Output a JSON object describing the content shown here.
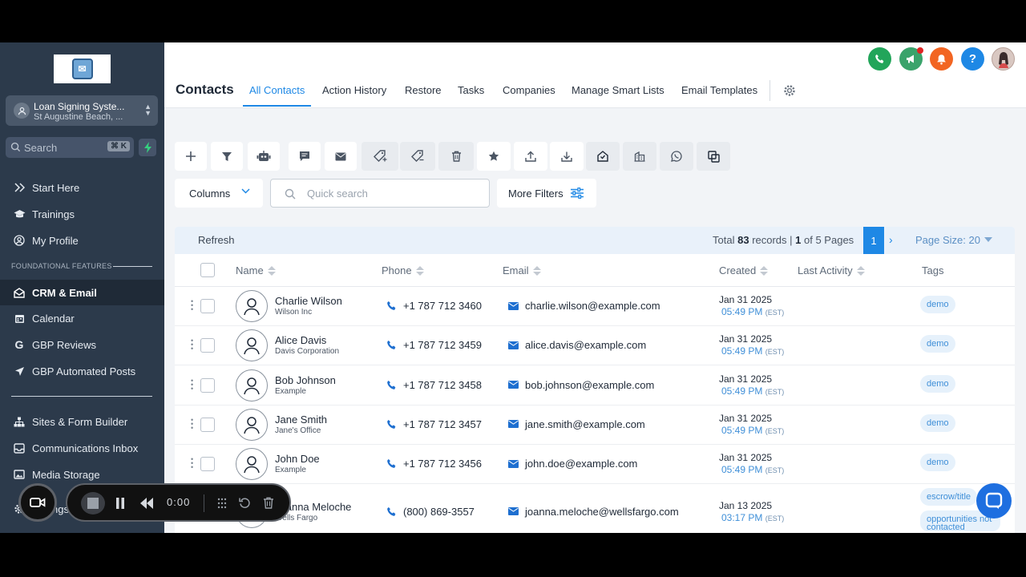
{
  "sidebar": {
    "location_name": "Loan Signing Syste...",
    "location_sub": "St Augustine Beach, ...",
    "search_placeholder": "Search",
    "search_shortcut": "⌘ K",
    "items": [
      {
        "label": "Start Here",
        "icon": "chevrons-right-icon"
      },
      {
        "label": "Trainings",
        "icon": "graduation-cap-icon"
      },
      {
        "label": "My Profile",
        "icon": "user-circle-icon"
      }
    ],
    "section_label": "FOUNDATIONAL FEATURES",
    "features": [
      {
        "label": "CRM & Email",
        "icon": "mail-open-icon",
        "active": true
      },
      {
        "label": "Calendar",
        "icon": "calendar-icon"
      },
      {
        "label": "GBP Reviews",
        "icon": "google-icon"
      },
      {
        "label": "GBP Automated Posts",
        "icon": "send-icon"
      }
    ],
    "more": [
      {
        "label": "Sites & Form Builder",
        "icon": "sitemap-icon"
      },
      {
        "label": "Communications Inbox",
        "icon": "inbox-icon"
      },
      {
        "label": "Media Storage",
        "icon": "image-icon"
      },
      {
        "label": "ngs",
        "icon": "settings-icon"
      }
    ]
  },
  "header": {
    "title": "Contacts",
    "tabs": [
      "All Contacts",
      "Action History",
      "Restore",
      "Tasks",
      "Companies",
      "Manage Smart Lists",
      "Email Templates"
    ],
    "active_tab": "All Contacts",
    "top_icons": [
      {
        "name": "phone-icon",
        "color": "#22a55a"
      },
      {
        "name": "megaphone-icon",
        "color": "#3aa36b"
      },
      {
        "name": "bell-icon",
        "color": "#f26522"
      },
      {
        "name": "help-icon",
        "color": "#1e88e5"
      }
    ]
  },
  "filters": {
    "columns_label": "Columns",
    "quick_search_placeholder": "Quick search",
    "more_filters_label": "More Filters"
  },
  "table": {
    "refresh_label": "Refresh",
    "total_prefix": "Total",
    "total_records": "83",
    "records_word": "records |",
    "page_current": "1",
    "of_pages": "of 5 Pages",
    "page_size_label": "Page Size: 20",
    "columns": [
      "Name",
      "Phone",
      "Email",
      "Created",
      "Last Activity",
      "Tags"
    ],
    "rows": [
      {
        "name": "Charlie Wilson",
        "company": "Wilson Inc",
        "phone": "+1 787 712 3460",
        "email": "charlie.wilson@example.com",
        "date": "Jan 31 2025",
        "time": "05:49 PM",
        "tz": "(EST)",
        "tag": "demo"
      },
      {
        "name": "Alice Davis",
        "company": "Davis Corporation",
        "phone": "+1 787 712 3459",
        "email": "alice.davis@example.com",
        "date": "Jan 31 2025",
        "time": "05:49 PM",
        "tz": "(EST)",
        "tag": "demo"
      },
      {
        "name": "Bob Johnson",
        "company": "Example",
        "phone": "+1 787 712 3458",
        "email": "bob.johnson@example.com",
        "date": "Jan 31 2025",
        "time": "05:49 PM",
        "tz": "(EST)",
        "tag": "demo"
      },
      {
        "name": "Jane Smith",
        "company": "Jane's Office",
        "phone": "+1 787 712 3457",
        "email": "jane.smith@example.com",
        "date": "Jan 31 2025",
        "time": "05:49 PM",
        "tz": "(EST)",
        "tag": "demo"
      },
      {
        "name": "John Doe",
        "company": "Example",
        "phone": "+1 787 712 3456",
        "email": "john.doe@example.com",
        "date": "Jan 31 2025",
        "time": "05:49 PM",
        "tz": "(EST)",
        "tag": "demo"
      },
      {
        "name": "Joanna Meloche",
        "company": "Wells Fargo",
        "phone": "(800) 869-3557",
        "email": "joanna.meloche@wellsfargo.com",
        "date": "Jan 13 2025",
        "time": "03:17 PM",
        "tz": "(EST)",
        "tag": "escrow/title",
        "tag2": "opportunities not contacted"
      }
    ]
  },
  "recorder": {
    "time": "0:00"
  }
}
